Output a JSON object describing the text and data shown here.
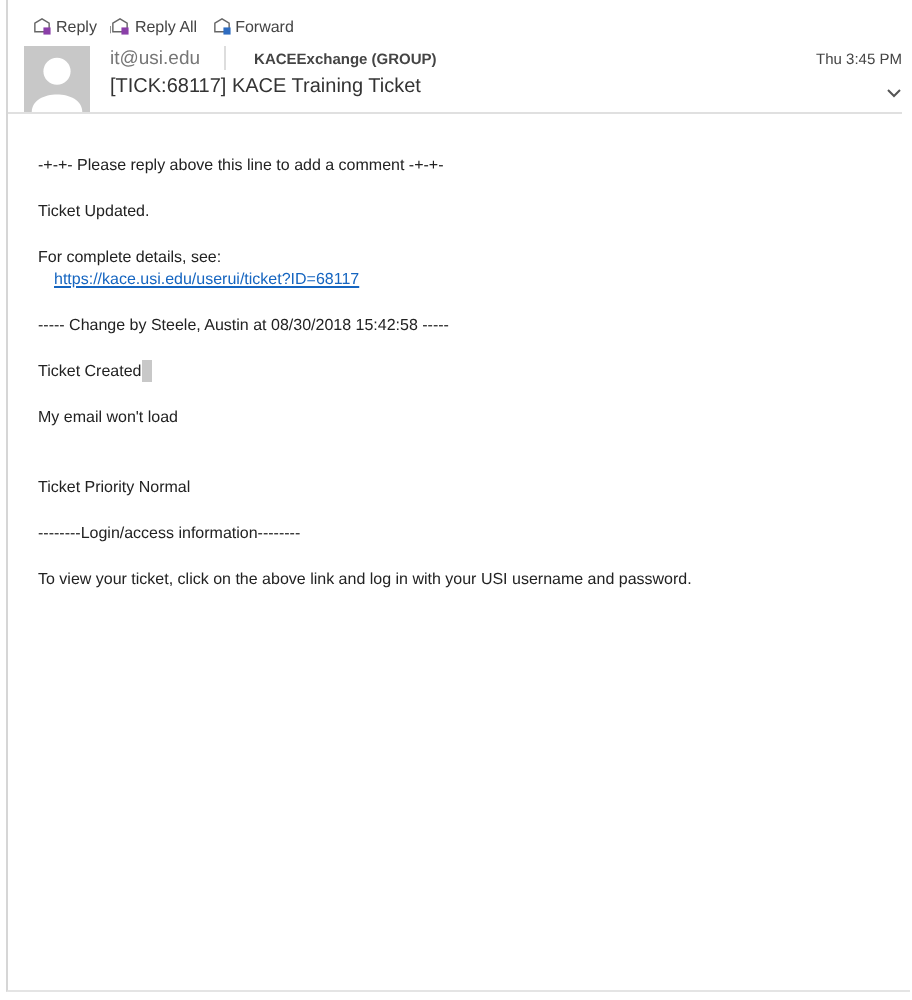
{
  "toolbar": [
    {
      "label": "Reply",
      "kind": "reply"
    },
    {
      "label": "Reply All",
      "kind": "reply-all"
    },
    {
      "label": "Forward",
      "kind": "forward"
    }
  ],
  "header": {
    "from": "it@usi.edu",
    "to": "KACEExchange (GROUP)",
    "time": "Thu 3:45 PM",
    "subject": "[TICK:68117] KACE Training Ticket"
  },
  "body": [
    {
      "kind": "text",
      "text": "-+-+-  Please reply above this line to add a comment  -+-+-"
    },
    {
      "kind": "text",
      "text": "Ticket Updated."
    },
    {
      "kind": "text",
      "text": "For complete details, see:"
    },
    {
      "kind": "link",
      "text": "https://kace.usi.edu/userui/ticket?ID=68117"
    },
    {
      "kind": "text",
      "text": "----- Change by Steele, Austin at 08/30/2018 15:42:58 -----"
    },
    {
      "kind": "text",
      "text": "Ticket Created",
      "cursor": true
    },
    {
      "kind": "text",
      "text": "My email won't load"
    },
    {
      "kind": "blank"
    },
    {
      "kind": "text",
      "text": "Ticket Priority Normal"
    },
    {
      "kind": "text",
      "text": "--------Login/access information--------"
    },
    {
      "kind": "text",
      "text": "To view your ticket, click on the above link and log in with your USI username and password."
    }
  ]
}
